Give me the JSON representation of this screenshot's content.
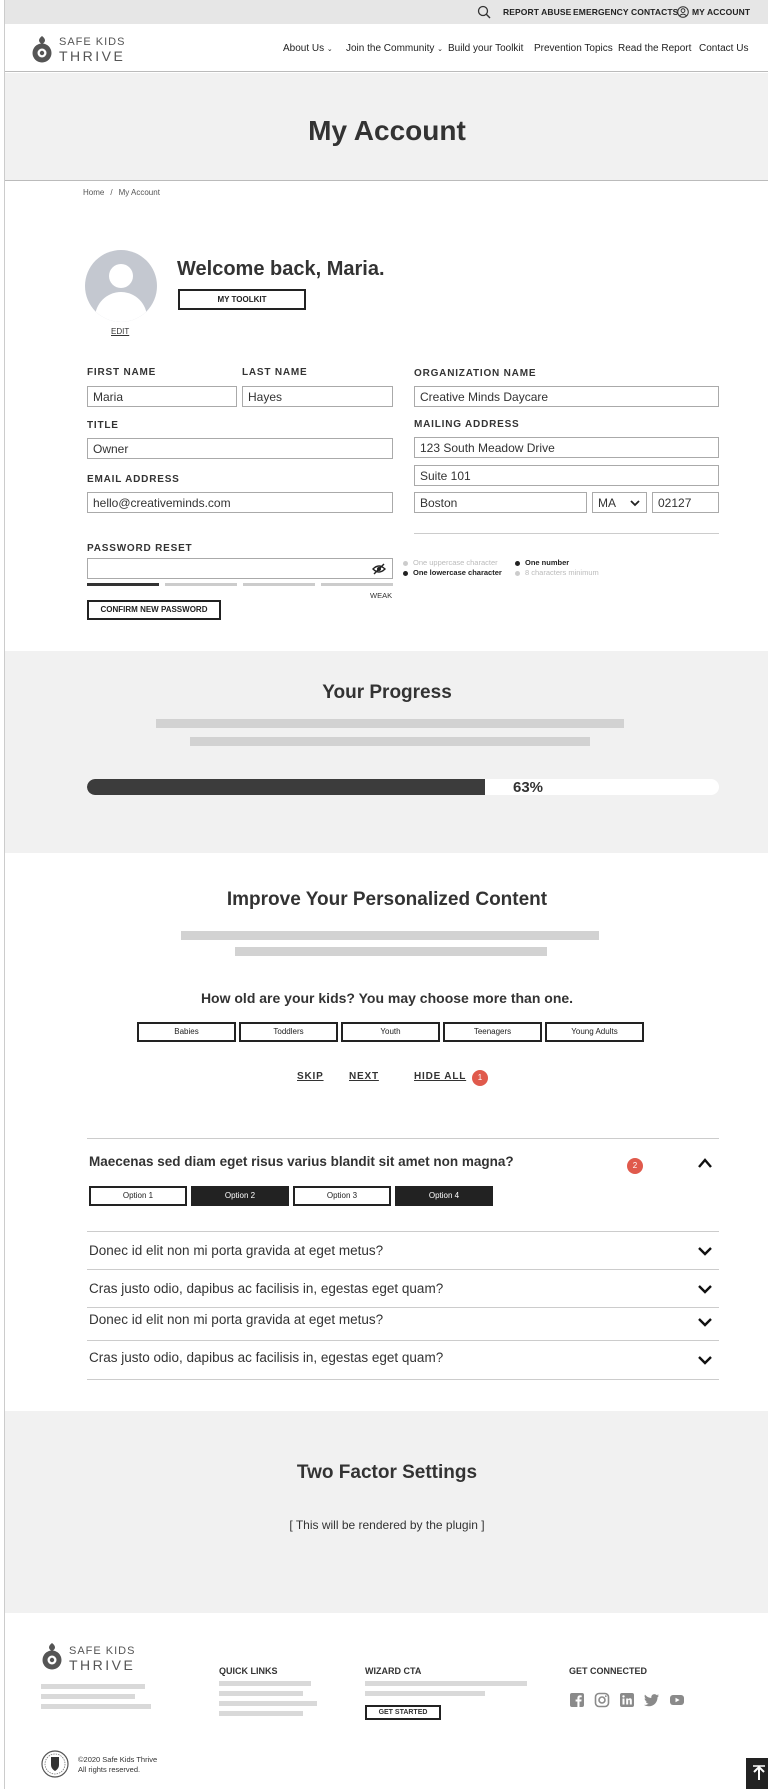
{
  "utility": {
    "report_abuse": "REPORT ABUSE",
    "emergency_contacts": "EMERGENCY CONTACTS",
    "my_account": "MY ACCOUNT"
  },
  "logo": {
    "line1": "SAFE KIDS",
    "line2": "THRIVE"
  },
  "nav": {
    "about": "About Us",
    "community": "Join the Community",
    "toolkit": "Build your Toolkit",
    "prevention": "Prevention Topics",
    "report": "Read the Report",
    "contact": "Contact Us"
  },
  "hero": {
    "title": "My Account"
  },
  "breadcrumb": {
    "home": "Home",
    "sep": "/",
    "current": "My Account"
  },
  "profile": {
    "edit_label": "EDIT",
    "welcome": "Welcome back, Maria.",
    "toolkit_button": "MY TOOLKIT"
  },
  "form": {
    "first_name_label": "FIRST NAME",
    "first_name": "Maria",
    "last_name_label": "LAST NAME",
    "last_name": "Hayes",
    "title_label": "TITLE",
    "title": "Owner",
    "email_label": "EMAIL ADDRESS",
    "email": "hello@creativeminds.com",
    "org_label": "ORGANIZATION NAME",
    "org": "Creative Minds Daycare",
    "address_label": "MAILING ADDRESS",
    "address1": "123 South Meadow Drive",
    "address2": "Suite 101",
    "city": "Boston",
    "state": "MA",
    "zip": "02127"
  },
  "password": {
    "label": "PASSWORD RESET",
    "strength_text": "WEAK",
    "strength_segments_filled": 1,
    "strength_segments_total": 4,
    "rules": [
      {
        "text": "One uppercase character",
        "met": false
      },
      {
        "text": "One number",
        "met": true
      },
      {
        "text": "One lowercase character",
        "met": true
      },
      {
        "text": "8 characters minimum",
        "met": false
      }
    ],
    "confirm_button": "CONFIRM NEW PASSWORD"
  },
  "progress": {
    "title": "Your Progress",
    "percent": 63,
    "percent_label": "63%"
  },
  "personalize": {
    "title": "Improve Your Personalized Content",
    "question": "How old are your kids? You may choose more than one.",
    "age_options": [
      "Babies",
      "Toddlers",
      "Youth",
      "Teenagers",
      "Young Adults"
    ],
    "skip": "SKIP",
    "next": "NEXT",
    "hide_all": "HIDE ALL",
    "hide_badge": "1"
  },
  "accordion": {
    "open_question": "Maecenas sed diam eget risus varius blandit sit amet non magna?",
    "open_badge": "2",
    "options": [
      {
        "label": "Option 1",
        "selected": false
      },
      {
        "label": "Option 2",
        "selected": true
      },
      {
        "label": "Option 3",
        "selected": false
      },
      {
        "label": "Option 4",
        "selected": true
      }
    ],
    "questions": [
      "Donec id elit non mi porta gravida at eget metus?",
      "Cras justo odio, dapibus ac facilisis in, egestas eget quam?",
      "Donec id elit non mi porta gravida at eget metus?",
      "Cras justo odio, dapibus ac facilisis in, egestas eget quam?"
    ]
  },
  "two_factor": {
    "title": "Two Factor Settings",
    "placeholder": "[ This will be rendered by the plugin ]"
  },
  "footer": {
    "logo_line1": "SAFE KIDS",
    "logo_line2": "THRIVE",
    "quick_links": "QUICK LINKS",
    "wizard_cta": "WIZARD CTA",
    "get_started": "GET STARTED",
    "get_connected": "GET CONNECTED",
    "copyright": "©2020 Safe Kids Thrive",
    "rights": "All rights reserved.",
    "social_icons": [
      "facebook-icon",
      "instagram-icon",
      "linkedin-icon",
      "twitter-icon",
      "youtube-icon"
    ]
  },
  "colors": {
    "badge": "#e05a4c",
    "dark": "#222222",
    "section_gray": "#f1f1f1",
    "placeholder_bar": "#d2d2d2"
  }
}
